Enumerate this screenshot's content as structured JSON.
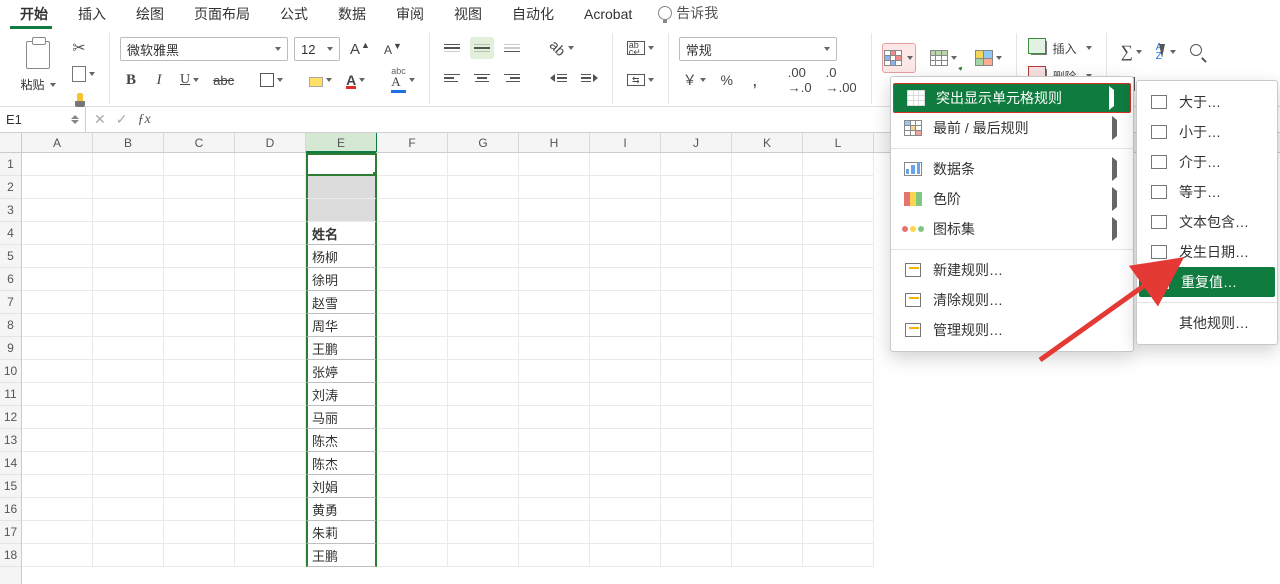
{
  "tabs": {
    "items": [
      "开始",
      "插入",
      "绘图",
      "页面布局",
      "公式",
      "数据",
      "审阅",
      "视图",
      "自动化",
      "Acrobat"
    ],
    "tellme": "告诉我"
  },
  "clipboard": {
    "paste": "粘贴"
  },
  "font": {
    "name": "微软雅黑",
    "size": "12",
    "bold": "B",
    "italic": "I",
    "underline": "U",
    "strike": "abc",
    "fontcolor_letter": "A",
    "phonetic_top": "abc",
    "phonetic_bottom": "A"
  },
  "number": {
    "format": "常规",
    "currency": "￥",
    "percent": "%",
    "comma": ",",
    "inc": ".00→.0",
    "dec": ".0→.00"
  },
  "cells_group": {
    "insert": "插入",
    "delete": "删除"
  },
  "namebox": "E1",
  "columns": [
    "A",
    "B",
    "C",
    "D",
    "E",
    "F",
    "G",
    "H",
    "I",
    "J",
    "K",
    "L"
  ],
  "rows_visible": 18,
  "selected_column": "E",
  "data": {
    "header": "姓名",
    "values": [
      "杨柳",
      "徐明",
      "赵雪",
      "周华",
      "王鹏",
      "张婷",
      "刘涛",
      "马丽",
      "陈杰",
      "陈杰",
      "刘娟",
      "黄勇",
      "朱莉",
      "王鹏"
    ]
  },
  "menu1": {
    "highlight": "突出显示单元格规则",
    "topbottom": "最前 / 最后规则",
    "databars": "数据条",
    "colorscales": "色阶",
    "iconsets": "图标集",
    "newrule": "新建规则…",
    "clear": "清除规则…",
    "manage": "管理规则…"
  },
  "menu2": {
    "gt": "大于…",
    "lt": "小于…",
    "between": "介于…",
    "equal": "等于…",
    "text": "文本包含…",
    "date": "发生日期…",
    "dup": "重复值…",
    "more": "其他规则…"
  }
}
